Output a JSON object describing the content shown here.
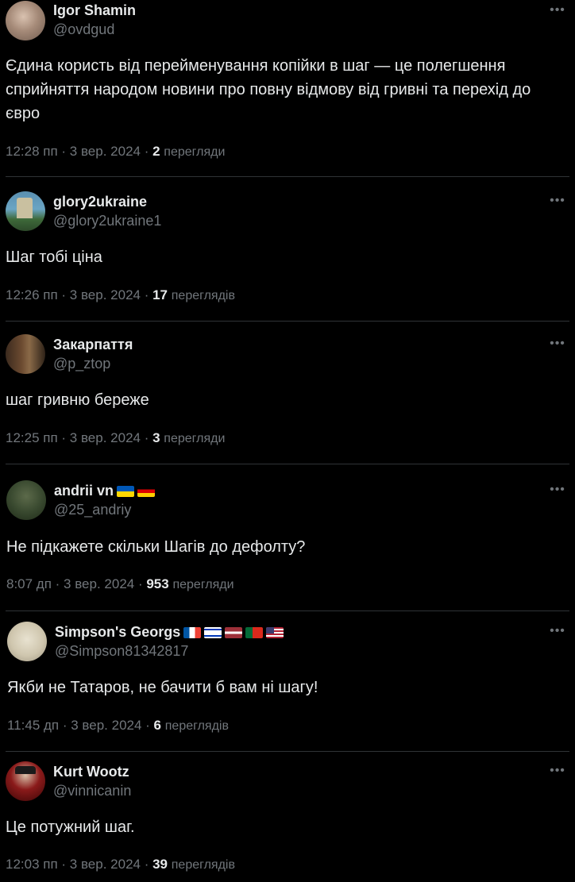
{
  "tweets": [
    {
      "name": "Igor Shamin",
      "handle": "@ovdgud",
      "text": "Єдина користь від перейменування копійки в шаг — це полегшення сприйняття народом новини про повну відмову від гривні та перехід до євро",
      "time": "12:28 пп · 3 вер. 2024 · ",
      "views": "2",
      "views_label": "перегляди"
    },
    {
      "name": "glory2ukraine",
      "handle": "@glory2ukraine1",
      "text": "Шаг тобі ціна",
      "time": "12:26 пп · 3 вер. 2024 · ",
      "views": "17",
      "views_label": "переглядів"
    },
    {
      "name": "Закарпаття",
      "handle": "@p_ztop",
      "text": "шаг гривню береже",
      "time": "12:25 пп · 3 вер. 2024 · ",
      "views": "3",
      "views_label": "перегляди"
    },
    {
      "name": "andrii vn",
      "handle": "@25_andriy",
      "text": "Не підкажете скільки Шагів до дефолту?",
      "time": "8:07 дп · 3 вер. 2024 · ",
      "views": "953",
      "views_label": "перегляди"
    },
    {
      "name": "Simpson's Georgs",
      "handle": "@Simpson81342817",
      "text": "Якби не Татаров, не бачити б вам ні шагу!",
      "time": "11:45 дп · 3 вер. 2024 · ",
      "views": "6",
      "views_label": "переглядів"
    },
    {
      "name": "Kurt Wootz",
      "handle": "@vinnicanin",
      "text": "Це потужний шаг.",
      "time": "12:03 пп · 3 вер. 2024 · ",
      "views": "39",
      "views_label": "переглядів"
    }
  ],
  "icons": {
    "more": "more-horizontal-icon"
  },
  "colors": {
    "background": "#000000",
    "text": "#e7e9ea",
    "muted": "#71767b",
    "divider": "#2f3336"
  }
}
